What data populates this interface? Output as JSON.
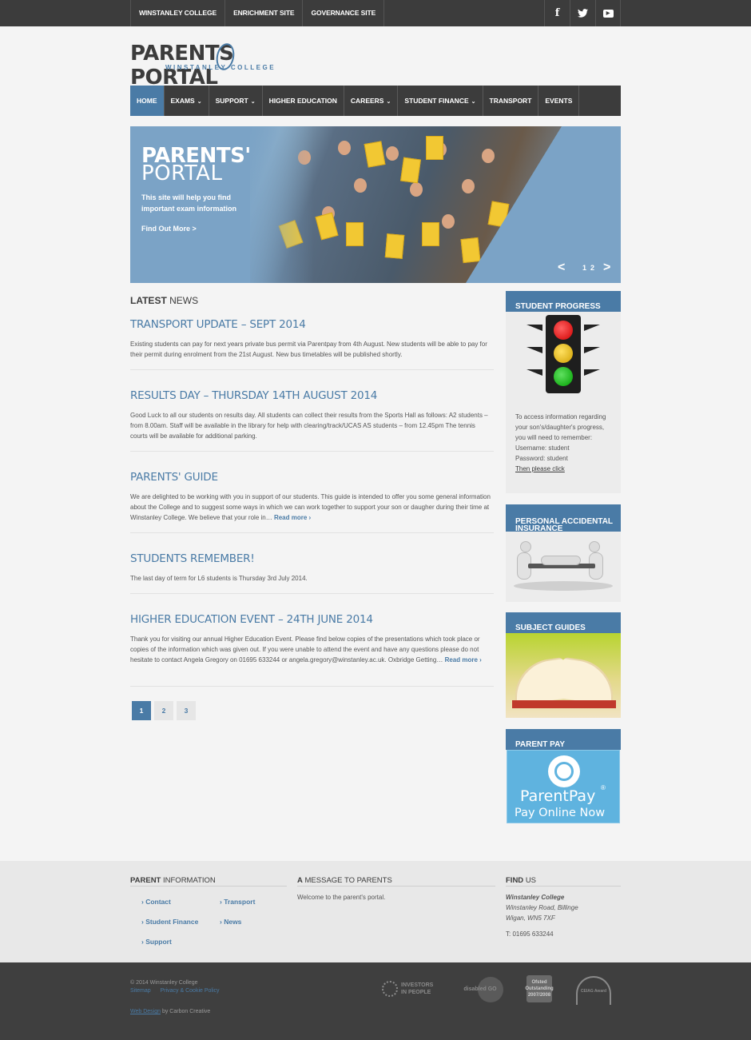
{
  "topbar": {
    "links": [
      "WINSTANLEY COLLEGE",
      "ENRICHMENT SITE",
      "GOVERNANCE SITE"
    ],
    "social": {
      "facebook": "f",
      "twitter": "t",
      "youtube": "▶"
    }
  },
  "logo": {
    "main": "PARENTS PORTAL",
    "sub": "WINSTANLEY COLLEGE"
  },
  "nav": {
    "items": [
      "HOME",
      "EXAMS",
      "SUPPORT",
      "HIGHER EDUCATION",
      "CAREERS",
      "STUDENT FINANCE",
      "TRANSPORT",
      "EVENTS"
    ],
    "caret": "⌄"
  },
  "hero": {
    "title_bold": "PARENTS'",
    "title_light": "PORTAL",
    "text": "This site will help you find important exam information",
    "link": "Find Out More >",
    "prev": "<",
    "next": ">",
    "pages": [
      "1",
      "2"
    ]
  },
  "latest": {
    "bold": "LATEST",
    "light": "NEWS"
  },
  "posts": [
    {
      "title": "TRANSPORT UPDATE – SEPT 2014",
      "body": "Existing students can pay for next years private bus permit via Parentpay from 4th August. New students will be able to pay for their permit during enrolment from the 21st August. New bus timetables will be published shortly."
    },
    {
      "title": "RESULTS DAY – THURSDAY 14TH AUGUST 2014",
      "body": "Good Luck to all our students on results day. All students can collect their results from the Sports Hall as follows: A2 students – from 8.00am. Staff will be available in the library for help with clearing/track/UCAS AS students – from 12.45pm The tennis courts will be available for additional parking."
    },
    {
      "title": "PARENTS' GUIDE",
      "body": "We are delighted to be working with you in support of our students. This guide is intended to offer you some general information about the College and to suggest some ways in which we can work together to support your son or daugher during their time at Winstanley College. We believe that your role in…",
      "more": "Read more ›"
    },
    {
      "title": "STUDENTS REMEMBER!",
      "body": "The last day of term for L6 students is Thursday 3rd July 2014."
    },
    {
      "title": "HIGHER EDUCATION EVENT – 24TH JUNE 2014",
      "body": "Thank you for visiting our annual Higher Education Event. Please find below copies of the presentations which took place or copies of the information which was given out. If you were unable to attend the event and have any questions please do not hesitate to contact Angela Gregory on 01695 633244 or angela.gregory@winstanley.ac.uk. Oxbridge Getting…",
      "more": "Read more ›"
    }
  ],
  "pager": [
    "1",
    "2",
    "3"
  ],
  "sidebar": {
    "progress": {
      "title": "STUDENT PROGRESS",
      "lines": [
        "To access information regarding your son's/daughter's progress, you will need to remember:",
        "Username: student",
        "Password: student"
      ],
      "link": "Then please click"
    },
    "insurance": {
      "title": "PERSONAL ACCIDENTAL INSURANCE"
    },
    "guides": {
      "title": "SUBJECT GUIDES"
    },
    "parentpay": {
      "title": "PARENT PAY",
      "brand": "ParentPay",
      "tag": "Pay Online Now",
      "reg": "®"
    }
  },
  "footer": {
    "parent_info": {
      "bold": "PARENT",
      "light": "INFORMATION"
    },
    "links": [
      "Contact",
      "Transport",
      "Student Finance",
      "News",
      "Support"
    ],
    "message": {
      "bold": "A",
      "light": "MESSAGE TO PARENTS",
      "text": "Welcome to the parent's portal."
    },
    "find": {
      "bold": "FIND",
      "light": "US",
      "name": "Winstanley College",
      "addr1": "Winstanley Road, Billinge",
      "addr2": "Wigan, WN5 7XF",
      "phone": "T: 01695 633244"
    }
  },
  "bottom": {
    "copyright": "© 2014 Winstanley College",
    "sitemap": "Sitemap",
    "privacy": "Privacy & Cookie Policy",
    "webdesign": "Web Design",
    "by": "by Carbon Creative",
    "badges": [
      "INVESTORS IN PEOPLE",
      "disabled GO",
      "Ofsted Outstanding 2007/2008",
      "CEIAG Award"
    ]
  }
}
